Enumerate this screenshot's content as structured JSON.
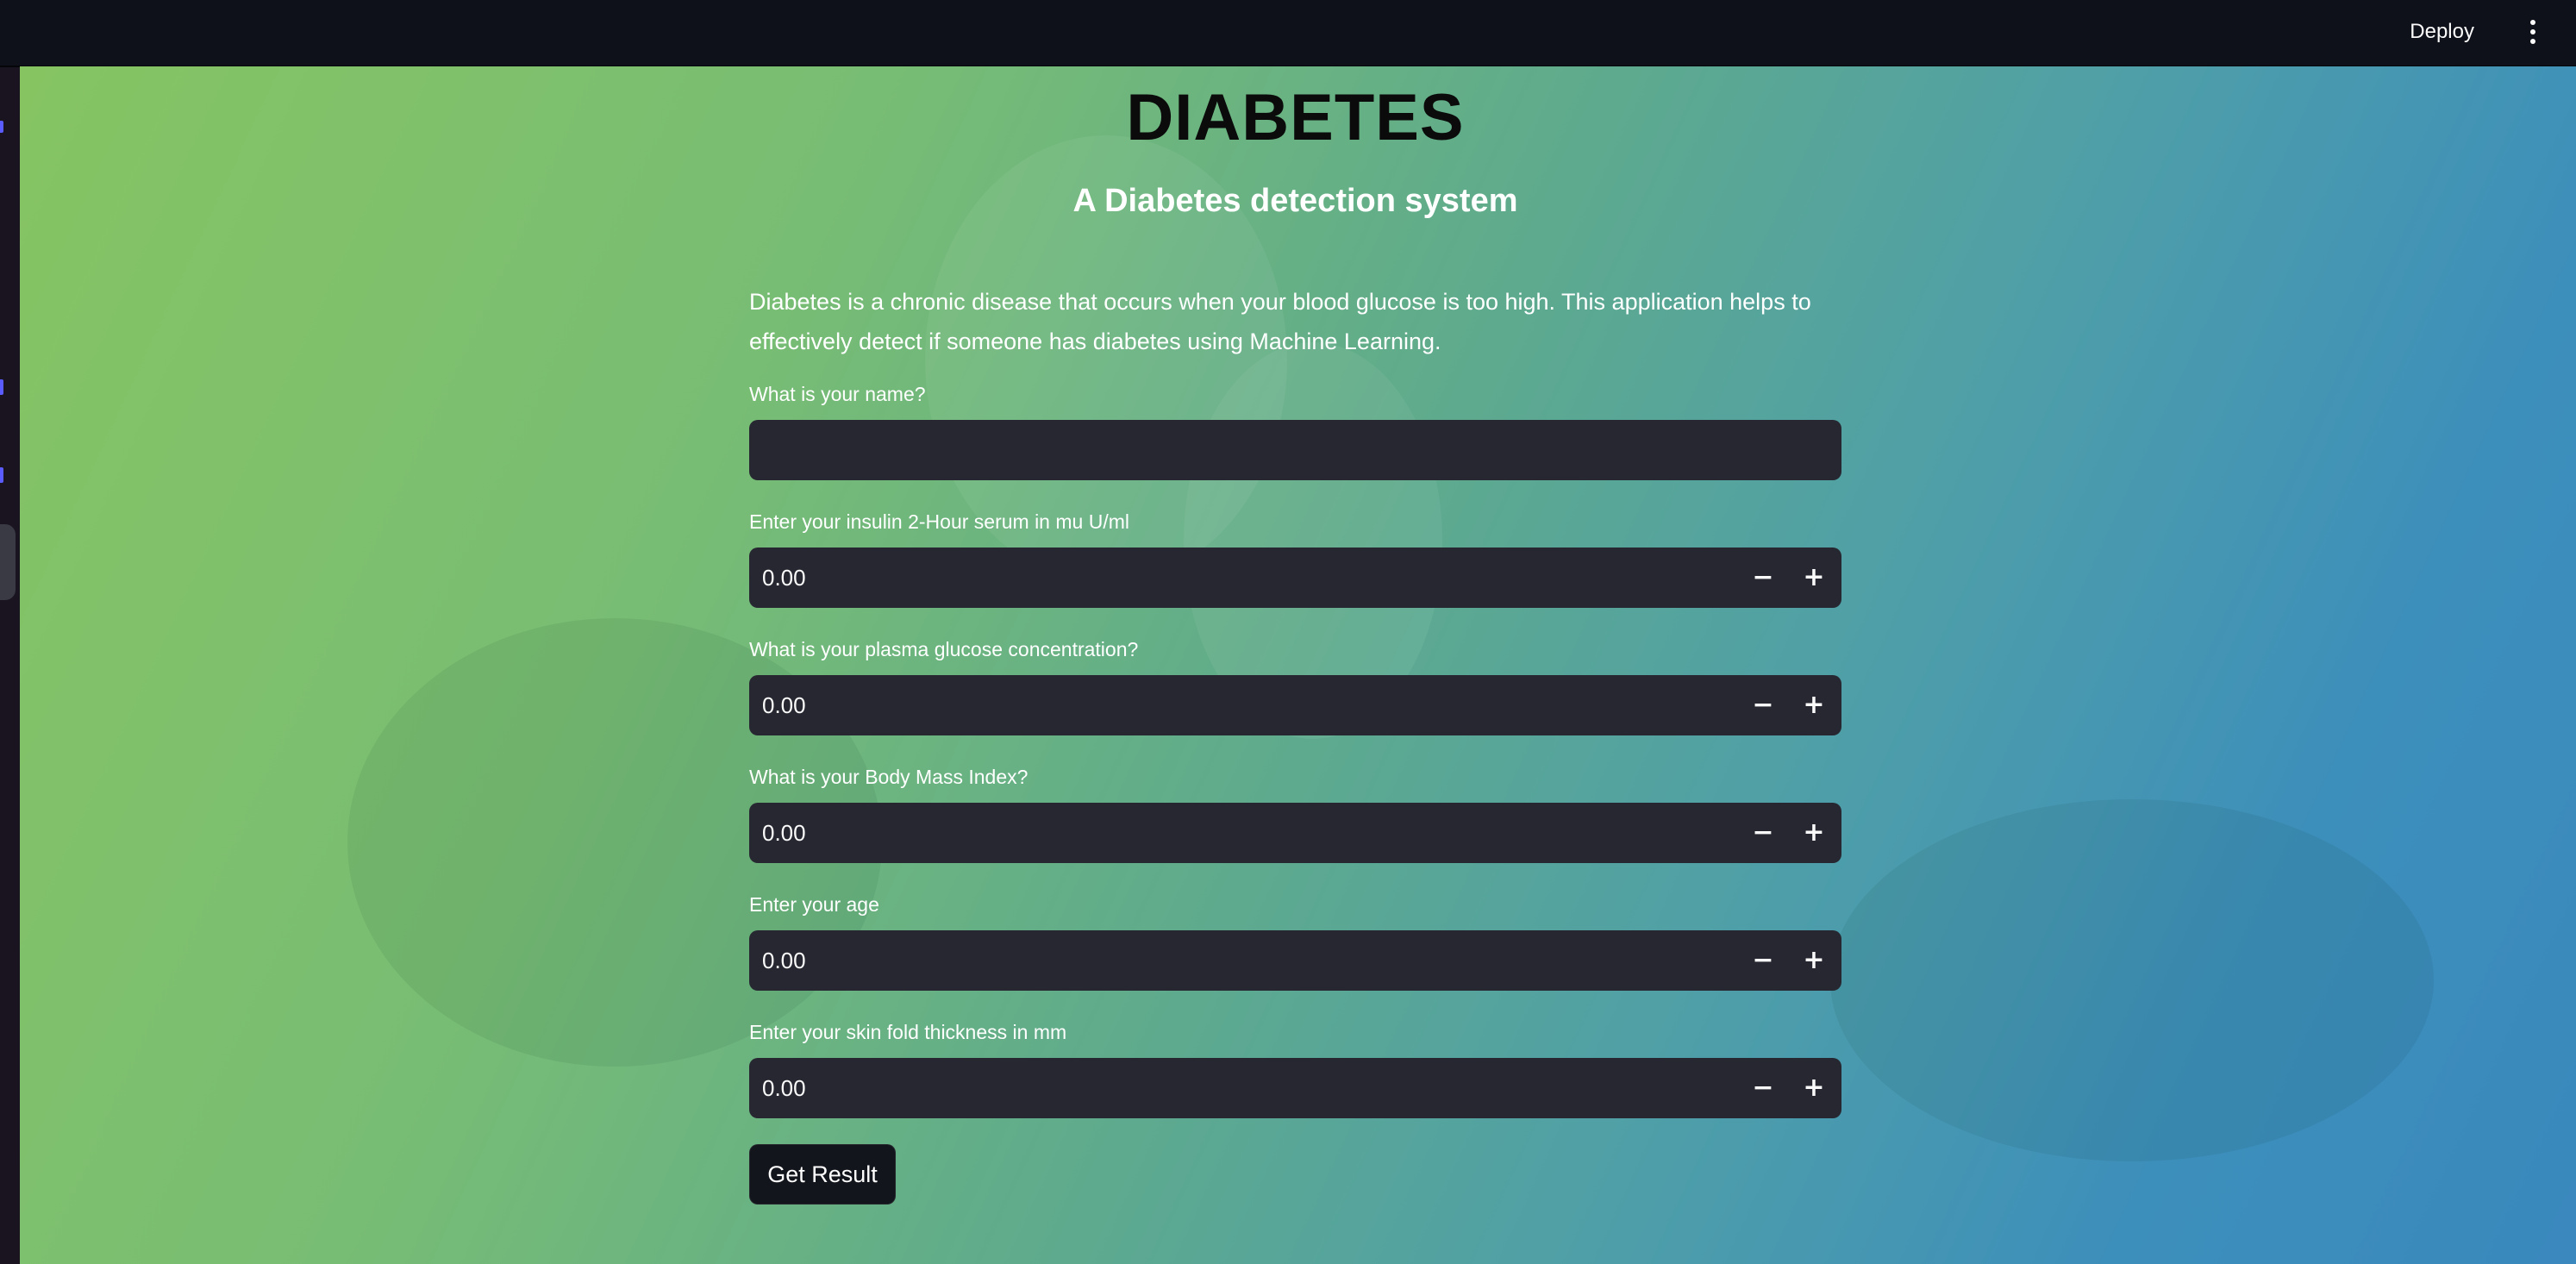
{
  "header": {
    "deploy_label": "Deploy",
    "menu_icon": "vertical-ellipsis-icon"
  },
  "page": {
    "title": "DIABETES",
    "subtitle": "A Diabetes detection system",
    "description": "Diabetes is a chronic disease that occurs when your blood glucose is too high. This application helps to effectively detect if someone has diabetes using Machine Learning."
  },
  "form": {
    "name_field": {
      "label": "What is your name?",
      "value": ""
    },
    "number_fields": [
      {
        "label": "Enter your insulin 2-Hour serum in mu U/ml",
        "value": "0.00",
        "minus": "−",
        "plus": "+"
      },
      {
        "label": "What is your plasma glucose concentration?",
        "value": "0.00",
        "minus": "−",
        "plus": "+"
      },
      {
        "label": "What is your Body Mass Index?",
        "value": "0.00",
        "minus": "−",
        "plus": "+"
      },
      {
        "label": "Enter your age",
        "value": "0.00",
        "minus": "−",
        "plus": "+"
      },
      {
        "label": "Enter your skin fold thickness in mm",
        "value": "0.00",
        "minus": "−",
        "plus": "+"
      }
    ],
    "submit_label": "Get Result"
  },
  "colors": {
    "header_bg": "#0f111a",
    "input_bg": "#262730",
    "button_bg": "#13151c",
    "gradient_start": "#86c462",
    "gradient_end": "#3a88bd"
  }
}
